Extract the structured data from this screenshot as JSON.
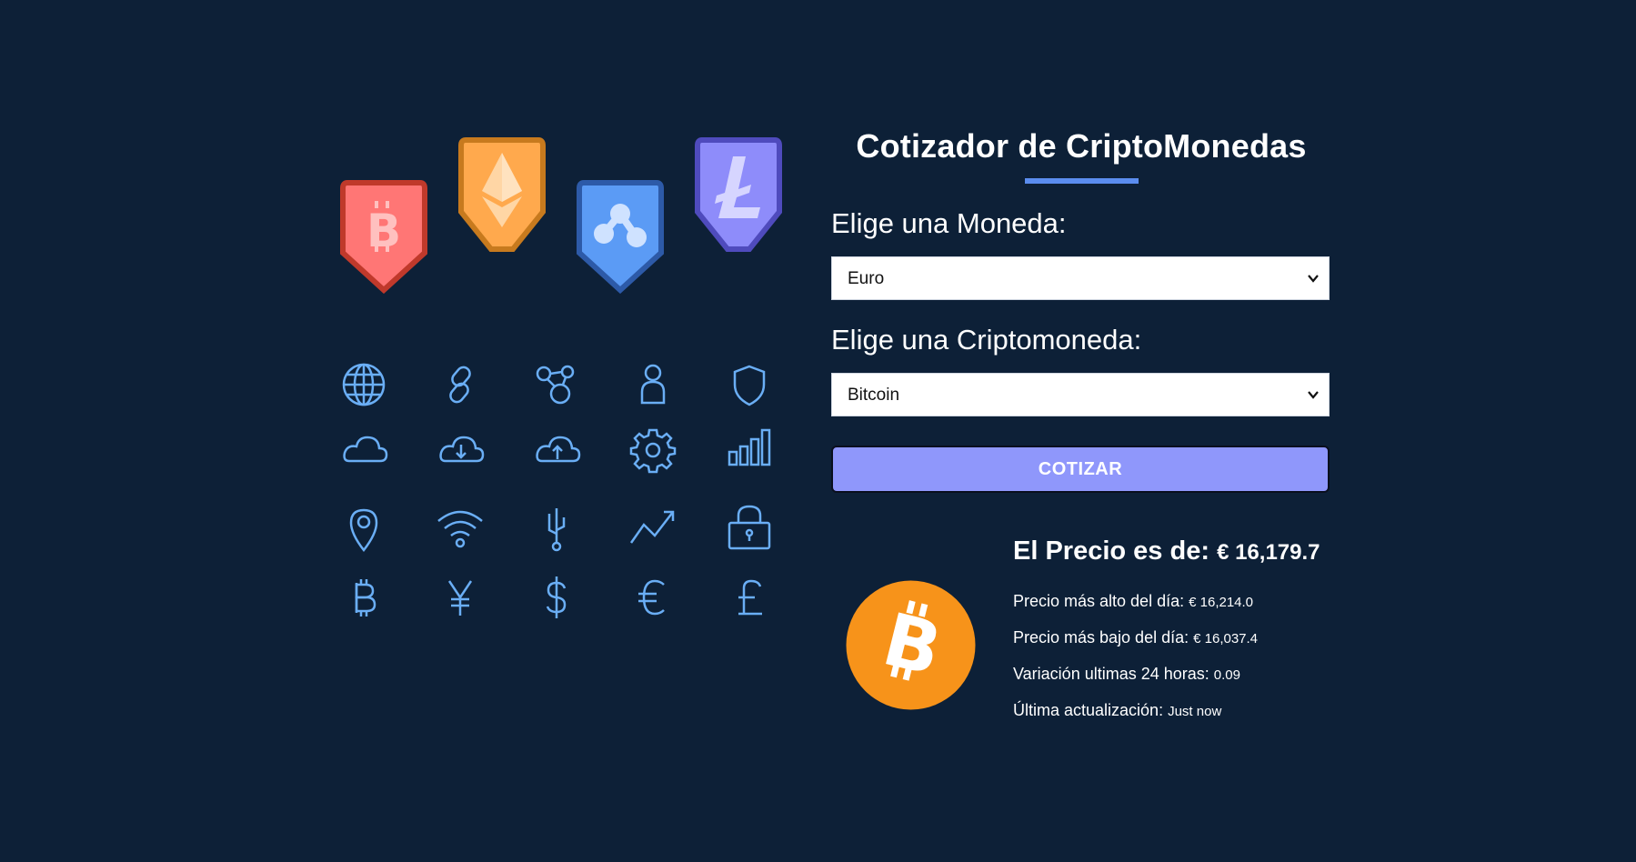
{
  "header": {
    "title": "Cotizador de CriptoMonedas"
  },
  "form": {
    "currency_label": "Elige una Moneda:",
    "currency_selected": "Euro",
    "crypto_label": "Elige una Criptomoneda:",
    "crypto_selected": "Bitcoin",
    "submit_label": "COTIZAR"
  },
  "result": {
    "price_label": "El Precio es de:",
    "price_value": "€ 16,179.7",
    "high_label": "Precio más alto del día:",
    "high_value": "€ 16,214.0",
    "low_label": "Precio más bajo del día:",
    "low_value": "€ 16,037.4",
    "change_label": "Variación ultimas 24 horas:",
    "change_value": "0.09",
    "updated_label": "Última actualización:",
    "updated_value": "Just now",
    "coin_icon": "bitcoin-coin-icon"
  },
  "illustration": {
    "badges": [
      "bitcoin-badge",
      "ethereum-badge",
      "ripple-badge",
      "litecoin-badge"
    ],
    "grid_icons": [
      "globe-icon",
      "link-icon",
      "network-icon",
      "user-icon",
      "shield-icon",
      "cloud-icon",
      "cloud-download-icon",
      "cloud-upload-icon",
      "gear-icon",
      "bar-chart-icon",
      "location-pin-icon",
      "wifi-icon",
      "usb-icon",
      "trend-up-icon",
      "lock-icon",
      "bitcoin-symbol-icon",
      "yen-symbol-icon",
      "dollar-symbol-icon",
      "euro-symbol-icon",
      "pound-symbol-icon"
    ]
  },
  "colors": {
    "background": "#0d2037",
    "accent_underline": "#5b8def",
    "button": "#8f97fb",
    "icon_stroke": "#6aaef5",
    "bitcoin_orange": "#f7931a"
  }
}
